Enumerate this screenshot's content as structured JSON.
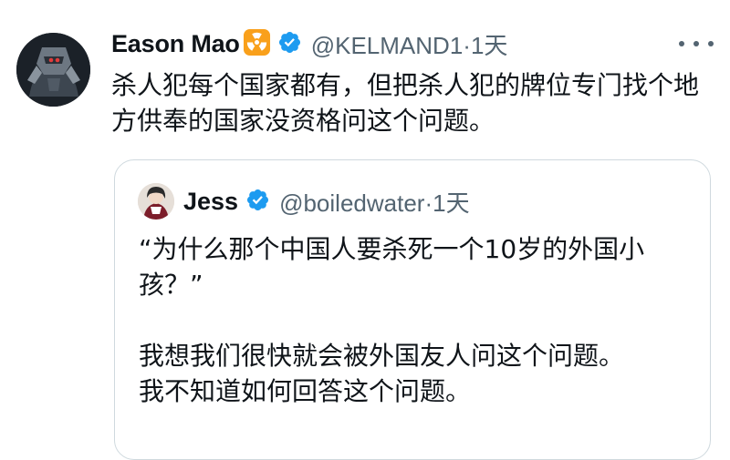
{
  "tweet": {
    "author_name": "Eason Mao",
    "author_handle": "@KELMAND1",
    "separator": "·",
    "time": "1天",
    "text": "杀人犯每个国家都有，但把杀人犯的牌位专门找个地方供奉的国家没资格问这个问题。"
  },
  "quoted": {
    "author_name": "Jess",
    "author_handle": "@boiledwater",
    "separator": "·",
    "time": "1天",
    "text": "“为什么那个中国人要杀死一个10岁的外国小孩？”\n\n我想我们很快就会被外国友人问这个问题。\n我不知道如何回答这个问题。"
  },
  "icons": {
    "verified": "verified-badge-icon",
    "emoji": "radiation-emoji-icon",
    "more": "more-options-icon"
  },
  "colors": {
    "verified_blue": "#1d9bf0",
    "secondary_text": "#536471",
    "border": "#cfd9de",
    "emoji_orange": "#f9a01b"
  }
}
